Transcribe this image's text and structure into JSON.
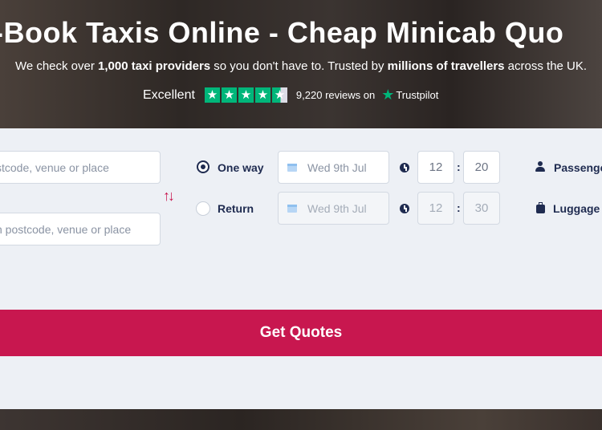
{
  "hero": {
    "title": "-Book Taxis Online - Cheap Minicab Quo",
    "subtitle_parts": [
      "We check over ",
      "1,000 taxi providers",
      " so you don't have to. Trusted by ",
      "millions of travellers",
      " across the UK."
    ]
  },
  "trustpilot": {
    "rating_text": "Excellent",
    "stars": 4.5,
    "reviews_text": "9,220 reviews on",
    "brand": "Trustpilot",
    "color": "#00b67a"
  },
  "form": {
    "pickup_placeholder": "stcode, venue or place",
    "dropoff_placeholder": "n postcode, venue or place",
    "swap_icon": "swap-arrows-icon",
    "trip_types": {
      "one_way": "One way",
      "return": "Return",
      "selected": "One way"
    },
    "outbound": {
      "date": "Wed 9th Jul",
      "hour": "12",
      "minute": "20"
    },
    "return_trip": {
      "date": "Wed 9th Jul",
      "hour": "12",
      "minute": "30"
    },
    "time_separator": ":",
    "passengers_label": "Passenge",
    "luggage_label": "Luggage"
  },
  "cta": {
    "label": "Get Quotes",
    "color": "#c8174f"
  }
}
